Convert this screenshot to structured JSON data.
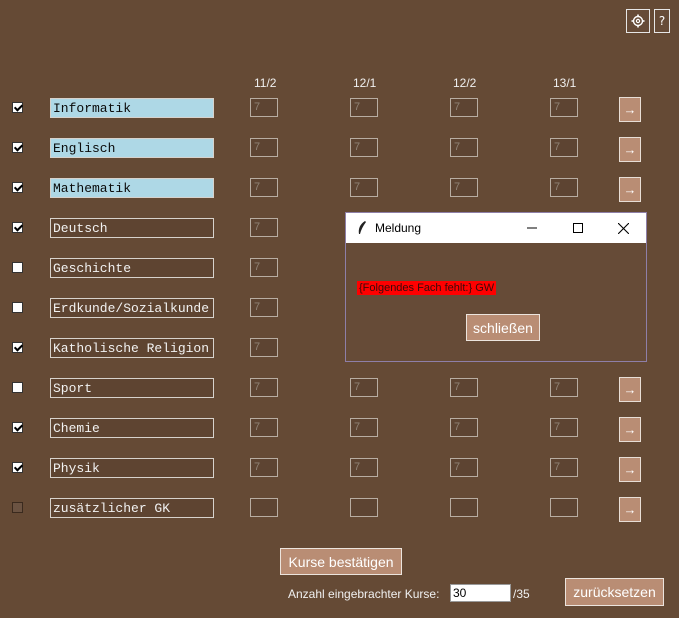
{
  "toolbar": {
    "settings_icon": "gear-icon",
    "help_label": "?"
  },
  "semesters": [
    "11/2",
    "12/1",
    "12/2",
    "13/1"
  ],
  "subjects": [
    {
      "name": "Informatik",
      "checked": true,
      "highlight": true
    },
    {
      "name": "Englisch",
      "checked": true,
      "highlight": true
    },
    {
      "name": "Mathematik",
      "checked": true,
      "highlight": true
    },
    {
      "name": "Deutsch",
      "checked": true,
      "highlight": false
    },
    {
      "name": "Geschichte",
      "checked": false,
      "highlight": false
    },
    {
      "name": "Erdkunde/Sozialkunde",
      "checked": false,
      "highlight": false
    },
    {
      "name": "Katholische Religion",
      "checked": true,
      "highlight": false
    },
    {
      "name": "Sport",
      "checked": false,
      "highlight": false
    },
    {
      "name": "Chemie",
      "checked": true,
      "highlight": false
    },
    {
      "name": "Physik",
      "checked": true,
      "highlight": false
    },
    {
      "name": "zusätzlicher GK",
      "checked": false,
      "highlight": false
    }
  ],
  "semester_value": "7",
  "arrow_label": "→",
  "confirm_button": "Kurse bestätigen",
  "count_label": "Anzahl eingebrachter Kurse:",
  "count_value": "30",
  "count_total": "/35",
  "reset_button": "zurücksetzen",
  "dialog": {
    "title": "Meldung",
    "message": "{Folgendes Fach fehlt:} GW",
    "close_button": "schließen"
  },
  "colors": {
    "background": "#654a35",
    "button": "#b98d74",
    "highlight": "#aed8e6",
    "error": "#ff0000"
  }
}
